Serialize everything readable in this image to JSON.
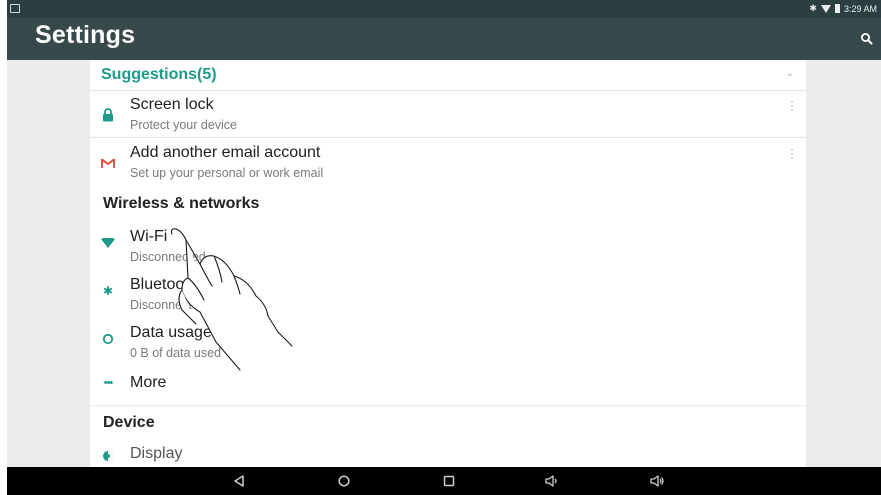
{
  "status_bar": {
    "time": "3:29 AM"
  },
  "app_bar": {
    "title": "Settings"
  },
  "suggestions": {
    "header": "Suggestions(5)",
    "items": [
      {
        "title": "Screen lock",
        "subtitle": "Protect your device",
        "icon": "lock-icon"
      },
      {
        "title": "Add another email account",
        "subtitle": "Set up your personal or work email",
        "icon": "gmail-icon"
      }
    ]
  },
  "wireless": {
    "header": "Wireless & networks",
    "items": [
      {
        "title": "Wi-Fi",
        "subtitle": "Disconnected",
        "icon": "wifi-icon"
      },
      {
        "title": "Bluetooth",
        "subtitle": "Disconnected",
        "icon": "bluetooth-icon"
      },
      {
        "title": "Data usage",
        "subtitle": "0 B of data used",
        "icon": "data-usage-icon"
      },
      {
        "title": "More",
        "subtitle": "",
        "icon": "more-icon"
      }
    ]
  },
  "device": {
    "header": "Device",
    "items": [
      {
        "title": "Display",
        "icon": "display-icon"
      }
    ]
  },
  "colors": {
    "status_bar": "#2b3f40",
    "app_bar": "#37494a",
    "accent": "#1e9a8a",
    "background": "#ececec"
  }
}
